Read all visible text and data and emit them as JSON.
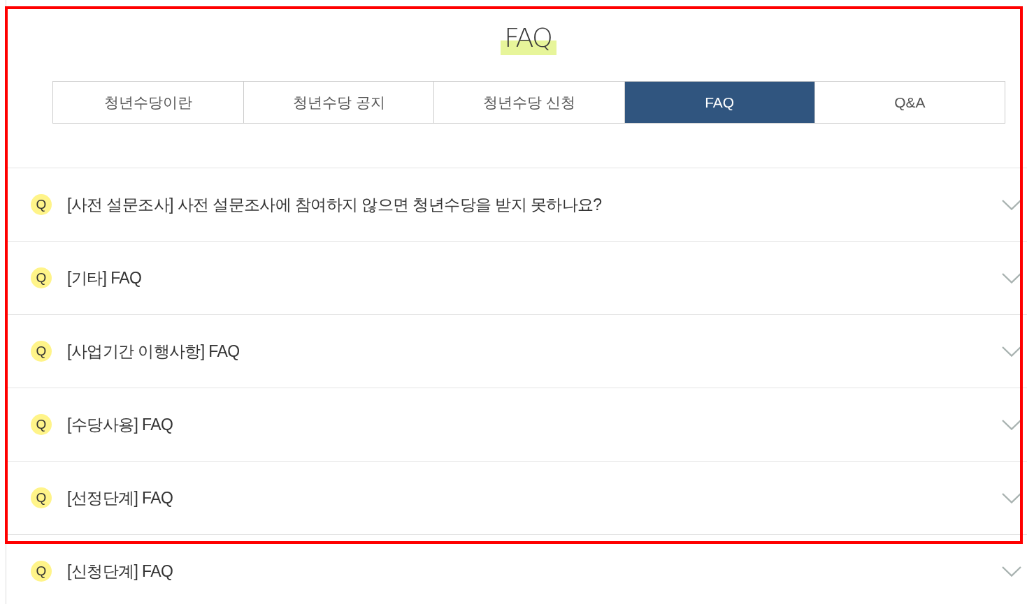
{
  "highlight_frame": {
    "shown": true
  },
  "title": "FAQ",
  "tabs": [
    {
      "label": "청년수당이란",
      "selected": false
    },
    {
      "label": "청년수당 공지",
      "selected": false
    },
    {
      "label": "청년수당 신청",
      "selected": false
    },
    {
      "label": "FAQ",
      "selected": true
    },
    {
      "label": "Q&A",
      "selected": false
    }
  ],
  "faq_items": [
    {
      "marker": "Q",
      "question": "[사전 설문조사] 사전 설문조사에 참여하지 않으면 청년수당을 받지 못하나요?",
      "expanded": false
    },
    {
      "marker": "Q",
      "question": "[기타] FAQ",
      "expanded": false
    },
    {
      "marker": "Q",
      "question": "[사업기간 이행사항] FAQ",
      "expanded": false
    },
    {
      "marker": "Q",
      "question": "[수당사용] FAQ",
      "expanded": false
    },
    {
      "marker": "Q",
      "question": "[선정단계] FAQ",
      "expanded": false
    },
    {
      "marker": "Q",
      "question": "[신청단계] FAQ",
      "expanded": false
    }
  ]
}
